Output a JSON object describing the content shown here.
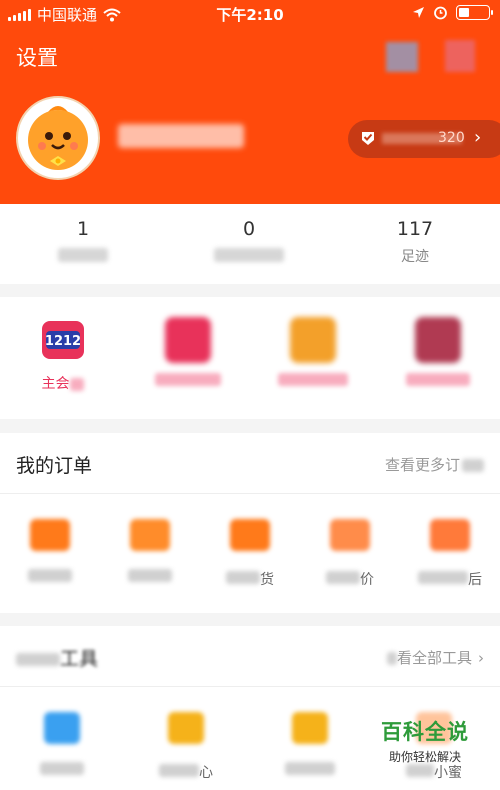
{
  "status_bar": {
    "carrier": "中国联通",
    "time": "下午2:10"
  },
  "header": {
    "settings_label": "设置",
    "vip_value": "320"
  },
  "counts": [
    {
      "number": "1",
      "label": ""
    },
    {
      "number": "0",
      "label": ""
    },
    {
      "number": "117",
      "label": "足迹"
    }
  ],
  "banners": [
    {
      "label": "主会",
      "badge": "1212"
    },
    {
      "label": ""
    },
    {
      "label": ""
    },
    {
      "label": ""
    }
  ],
  "orders": {
    "title": "我的订单",
    "more_label": "查看更多订",
    "items": [
      {
        "label": ""
      },
      {
        "label": ""
      },
      {
        "label": "货"
      },
      {
        "label": "价"
      },
      {
        "label": "后"
      }
    ]
  },
  "tools": {
    "title": "工具",
    "more_label": "看全部工具",
    "items": [
      {
        "label": ""
      },
      {
        "label": "心"
      },
      {
        "label": ""
      },
      {
        "label": "小蜜"
      }
    ]
  },
  "watermark": {
    "title": "百科全说",
    "subtitle": "助你轻松解决"
  },
  "colors": {
    "brand": "#ff4a0c",
    "accent_pink": "#e8325a",
    "watermark_green": "#2e9b3a"
  }
}
